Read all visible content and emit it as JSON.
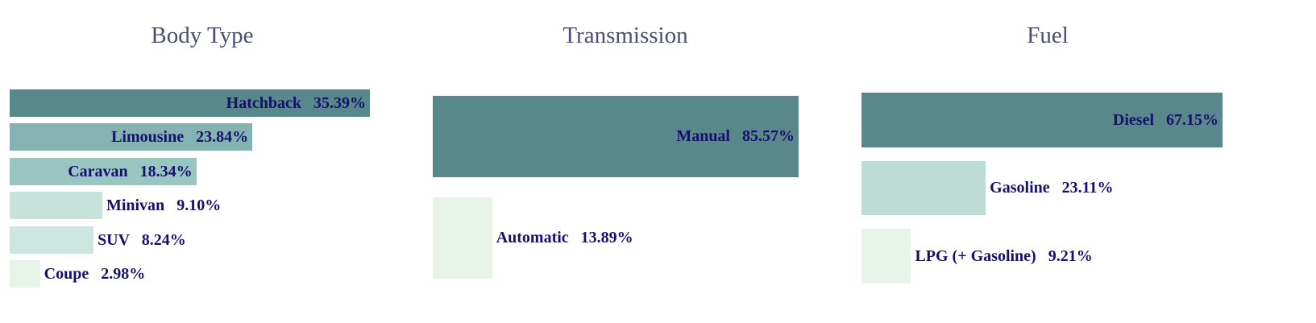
{
  "chart_data": [
    {
      "type": "bar",
      "orientation": "horizontal",
      "title": "Body Type",
      "categories": [
        "Hatchback",
        "Limousine",
        "Caravan",
        "Minivan",
        "SUV",
        "Coupe"
      ],
      "values": [
        35.39,
        23.84,
        18.34,
        9.1,
        8.24,
        2.98
      ],
      "labels": [
        "35.39%",
        "23.84%",
        "18.34%",
        "9.10%",
        "8.24%",
        "2.98%"
      ],
      "unit": "%",
      "colors": [
        "#59888c",
        "#84b3b1",
        "#9ac6c2",
        "#c6e2db",
        "#cde6df",
        "#e8f4ea"
      ]
    },
    {
      "type": "bar",
      "orientation": "horizontal",
      "title": "Transmission",
      "categories": [
        "Manual",
        "Automatic"
      ],
      "values": [
        85.57,
        13.89
      ],
      "labels": [
        "85.57%",
        "13.89%"
      ],
      "unit": "%",
      "colors": [
        "#59888c",
        "#e8f4ea"
      ]
    },
    {
      "type": "bar",
      "orientation": "horizontal",
      "title": "Fuel",
      "categories": [
        "Diesel",
        "Gasoline",
        "LPG (+ Gasoline)"
      ],
      "values": [
        67.15,
        23.11,
        9.21
      ],
      "labels": [
        "67.15%",
        "23.11%",
        "9.21%"
      ],
      "unit": "%",
      "colors": [
        "#59888c",
        "#bddcd5",
        "#e8f4ea"
      ]
    }
  ]
}
